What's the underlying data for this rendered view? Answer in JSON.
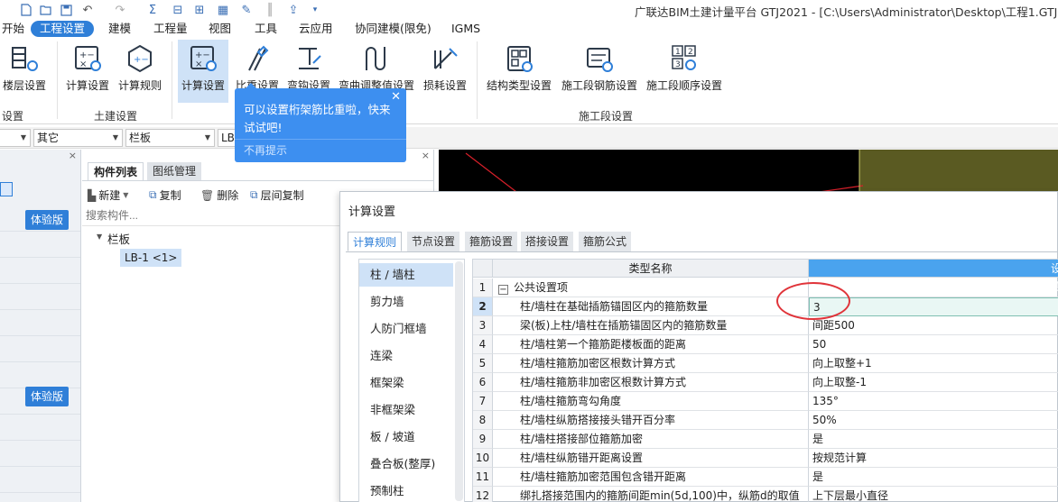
{
  "titlebar": {
    "title": "广联达BIM土建计量平台 GTJ2021 - [C:\\Users\\Administrator\\Desktop\\工程1.GTJ]"
  },
  "menu": {
    "items": [
      "开始",
      "工程设置",
      "建模",
      "工程量",
      "视图",
      "工具",
      "云应用",
      "协同建模(限免)",
      "IGMS"
    ],
    "active": "工程设置"
  },
  "ribbon": {
    "buttons": {
      "floor": "楼层设置",
      "calc": "计算设置",
      "rules": "计算规则",
      "calc2": "计算设置",
      "weight": "比重设置",
      "hook": "弯钩设置",
      "bend": "弯曲调整值设置",
      "loss": "损耗设置",
      "struct": "结构类型设置",
      "rebar": "施工段钢筋设置",
      "order": "施工段顺序设置"
    },
    "groups": {
      "g0": "设置",
      "g1": "土建设置",
      "g2": "施工段设置"
    }
  },
  "selector": {
    "c1": "其它",
    "c2": "栏板",
    "c3": "LB"
  },
  "leftstrip": {
    "trial": "体验版"
  },
  "complist": {
    "tab_components": "构件列表",
    "tab_drawings": "图纸管理",
    "tools": {
      "new": "新建",
      "copy": "复制",
      "delete": "删除",
      "floor_copy": "层间复制"
    },
    "search_placeholder": "搜索构件...",
    "tree_root": "栏板",
    "tree_child": "LB-1 <1>"
  },
  "tooltip": {
    "text": "可以设置桁架筋比重啦，快来试试吧!",
    "dismiss": "不再提示"
  },
  "dialog": {
    "title": "计算设置",
    "tabs": [
      "计算规则",
      "节点设置",
      "箍筋设置",
      "搭接设置",
      "箍筋公式"
    ],
    "active_tab": "计算规则",
    "categories": [
      "柱 / 墙柱",
      "剪力墙",
      "人防门框墙",
      "连梁",
      "框架梁",
      "非框架梁",
      "板 / 坡道",
      "叠合板(整厚)",
      "预制柱"
    ],
    "selected_category": "柱 / 墙柱",
    "grid": {
      "col_name": "类型名称",
      "col_value": "设置",
      "rows": [
        {
          "no": "1",
          "name": "公共设置项",
          "value": "",
          "group": true
        },
        {
          "no": "2",
          "name": "柱/墙柱在基础插筋锚固区内的箍筋数量",
          "value": "3",
          "selected": true
        },
        {
          "no": "3",
          "name": "梁(板)上柱/墙柱在插筋锚固区内的箍筋数量",
          "value": "间距500"
        },
        {
          "no": "4",
          "name": "柱/墙柱第一个箍筋距楼板面的距离",
          "value": "50"
        },
        {
          "no": "5",
          "name": "柱/墙柱箍筋加密区根数计算方式",
          "value": "向上取整+1"
        },
        {
          "no": "6",
          "name": "柱/墙柱箍筋非加密区根数计算方式",
          "value": "向上取整-1"
        },
        {
          "no": "7",
          "name": "柱/墙柱箍筋弯勾角度",
          "value": "135°"
        },
        {
          "no": "8",
          "name": "柱/墙柱纵筋搭接接头错开百分率",
          "value": "50%"
        },
        {
          "no": "9",
          "name": "柱/墙柱搭接部位箍筋加密",
          "value": "是"
        },
        {
          "no": "10",
          "name": "柱/墙柱纵筋错开距离设置",
          "value": "按规范计算"
        },
        {
          "no": "11",
          "name": "柱/墙柱箍筋加密范围包含错开距离",
          "value": "是"
        },
        {
          "no": "12",
          "name": "绑扎搭接范围内的箍筋间距min(5d,100)中，纵筋d的取值",
          "value": "上下层最小直径"
        }
      ]
    }
  },
  "colors": {
    "accent": "#2f7fd8",
    "tooltip": "#3d8ff0",
    "highlight": "#cfe2f7",
    "annotation": "#e0343a"
  }
}
